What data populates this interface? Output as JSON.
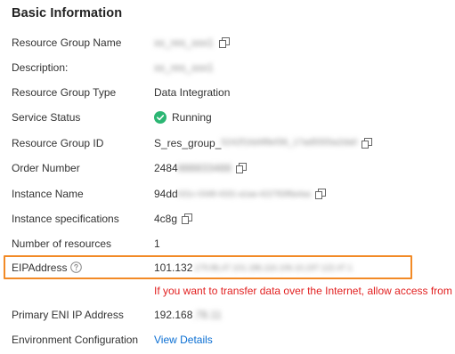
{
  "section": {
    "title": "Basic Information"
  },
  "fields": {
    "resource_group_name": {
      "label": "Resource Group Name",
      "value": "xx_res_xxx1"
    },
    "description": {
      "label": "Description:",
      "value": "xx_res_xxx1"
    },
    "resource_group_type": {
      "label": "Resource Group Type",
      "value": "Data Integration"
    },
    "service_status": {
      "label": "Service Status",
      "value": "Running",
      "status_color": "#2bb673",
      "icon": "check-circle-icon"
    },
    "resource_group_id": {
      "label": "Resource Group ID",
      "value_prefix": "S_res_group_",
      "value_masked": "5242f16d4f8ef36_17ad5555a2da0"
    },
    "order_number": {
      "label": "Order Number",
      "value_prefix": "2484",
      "value_masked": "888833488"
    },
    "instance_name": {
      "label": "Instance Name",
      "value_prefix": "94dd",
      "value_masked": "631c-0348-4331-a1aa-422783f8a4aa"
    },
    "instance_specifications": {
      "label": "Instance specifications",
      "value": "4c8g"
    },
    "number_of_resources": {
      "label": "Number of resources",
      "value": "1"
    },
    "eip_address": {
      "label": "EIPAddress",
      "value_prefix": "101.132",
      "value_masked": ".179.86,47.101.186,116.106.10,197.122.47.1"
    },
    "eip_warning": "If you want to transfer data over the Internet, allow access from",
    "primary_eni_ip": {
      "label": "Primary ENI IP Address",
      "value_prefix": "192.168",
      "value_masked": ".78.11"
    },
    "environment_configuration": {
      "label": "Environment Configuration",
      "link": "View Details"
    }
  },
  "colors": {
    "highlight_border": "#f28a26",
    "warning_text": "#e22222",
    "link": "#0b6fd3",
    "status_ok": "#2bb673"
  }
}
